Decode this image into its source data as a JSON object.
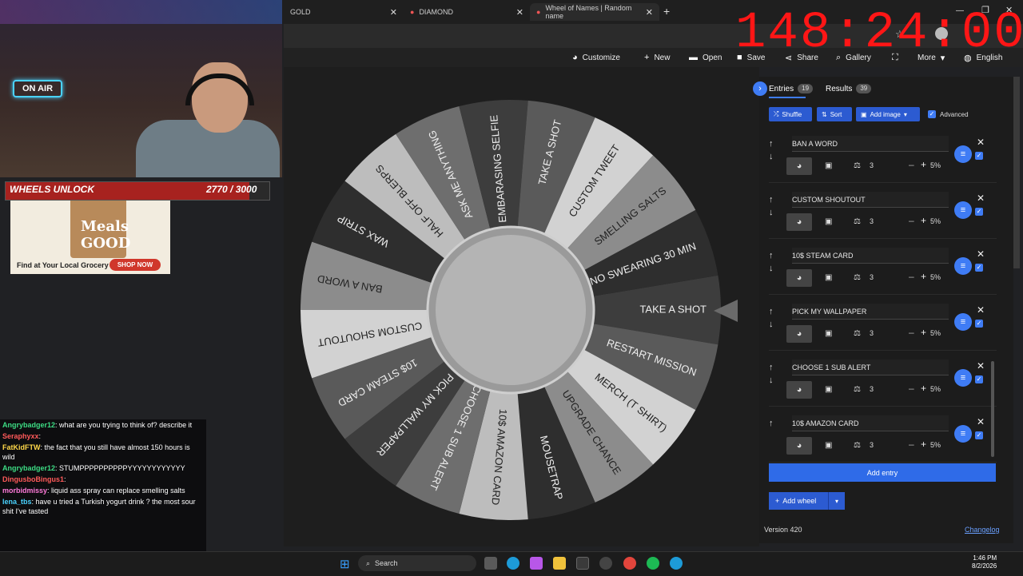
{
  "browser": {
    "tabs": [
      {
        "label": "GOLD"
      },
      {
        "label": "DIAMOND"
      },
      {
        "label": "Wheel of Names | Random name"
      }
    ],
    "new_tab_label": "+"
  },
  "overlay": {
    "timer": "148:24:00",
    "on_air": "ON AIR",
    "unlock_label": "WHEELS UNLOCK",
    "unlock_count": "2770 / 3000",
    "unlock_fraction": 0.923,
    "ad": {
      "brand": "Meals GOOD",
      "tagline": "Find at Your Local Grocery",
      "cta": "SHOP NOW"
    }
  },
  "chat": [
    {
      "user": "Angrybadger12",
      "text": ": what are you trying to think of? describe it",
      "color": "#3ddc84"
    },
    {
      "user": "Seraphyxx",
      "text": ":",
      "color": "#ff5a5a"
    },
    {
      "user": "FatKidFTW",
      "text": ": the fact that you still have almost 150 hours is wild",
      "color": "#ffd84a"
    },
    {
      "user": "Angrybadger12",
      "text": ": STUMPPPPPPPPPPYYYYYYYYYYYY",
      "color": "#3ddc84"
    },
    {
      "user": "DingusboBingus1",
      "text": ":",
      "color": "#ff5a5a"
    },
    {
      "user": "morbidmissy",
      "text": ": liquid ass spray can replace smelling salts",
      "color": "#ff7ad9"
    },
    {
      "user": "lena_tbs",
      "text": ": have u tried a Turkish yogurt drink ? the most sour shit I've tasted",
      "color": "#4ad3ff"
    }
  ],
  "menu": {
    "customize": "Customize",
    "new": "New",
    "open": "Open",
    "save": "Save",
    "share": "Share",
    "gallery": "Gallery",
    "more": "More",
    "language": "English"
  },
  "wheel": {
    "segments": [
      "TAKE A SHOT",
      "RESTART MISSION",
      "MERCH (T SHIRT)",
      "UPGRADE CHANCE",
      "MOUSETRAP",
      "10$ AMAZON CARD",
      "CHOOSE 1 SUB ALERT",
      "PICK MY WALLPAPER",
      "10$ STEAM CARD",
      "CUSTOM SHOUTOUT",
      "BAN A WORD",
      "WAX STRIP",
      "HALF OFF BLERPS",
      "ASK ME ANYTHING",
      "EMBARASING SELFIE",
      "TAKE A SHOT",
      "CUSTOM TWEET",
      "SMELLING SALTS",
      "NO SWEARING 30 MIN"
    ]
  },
  "panel": {
    "entries_tab": "Entries",
    "entries_count": "19",
    "results_tab": "Results",
    "results_count": "39",
    "shuffle": "Shuffle",
    "sort": "Sort",
    "add_image": "Add image",
    "advanced": "Advanced",
    "entries": [
      {
        "text": "BAN A WORD",
        "weight": "3",
        "percent": "5%"
      },
      {
        "text": "CUSTOM SHOUTOUT",
        "weight": "3",
        "percent": "5%"
      },
      {
        "text": "10$ STEAM CARD",
        "weight": "3",
        "percent": "5%"
      },
      {
        "text": "PICK MY WALLPAPER",
        "weight": "3",
        "percent": "5%"
      },
      {
        "text": "CHOOSE 1 SUB ALERT",
        "weight": "3",
        "percent": "5%"
      },
      {
        "text": "10$ AMAZON CARD",
        "weight": "3",
        "percent": "5%"
      }
    ],
    "add_entry": "Add entry",
    "add_wheel": "Add wheel",
    "version": "Version 420",
    "changelog": "Changelog"
  },
  "taskbar": {
    "search": "Search",
    "time": "1:46 PM",
    "date": "8/2/2026"
  }
}
